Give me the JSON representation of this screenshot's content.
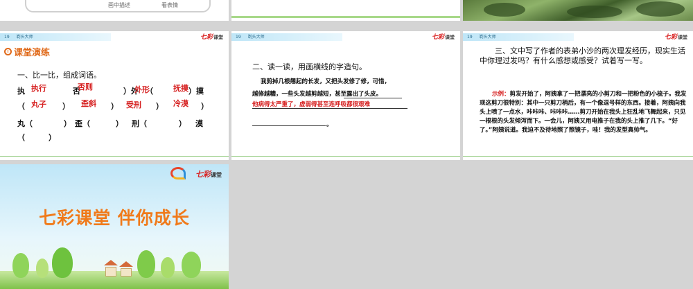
{
  "top_slides": {
    "slide_a": {
      "text1": "画中描述",
      "text2": "看表情"
    }
  },
  "slide_header": {
    "number": "19",
    "lesson": "剃头大师"
  },
  "logo": {
    "brand": "七彩",
    "sub": "课堂"
  },
  "slide1": {
    "title": "课堂演练",
    "question": "一、比一比，组成词语。",
    "row1": {
      "c1": "执",
      "a1": "执行",
      "c2": "否",
      "a2": "否则",
      "c3": "）外",
      "a3": "外形",
      "c4": "（",
      "a4": "抚摸",
      "c5": "）摸"
    },
    "row2": {
      "c1": "（",
      "a1": "丸子",
      "c2": "）",
      "a2": "歪斜",
      "c3": "）",
      "a3": "受刑",
      "c4": "）",
      "a4": "冷漠",
      "c5": "）"
    },
    "row3": {
      "c1": "丸（",
      "c2": "）",
      "c3": "歪（",
      "c4": "）",
      "c5": "刑（",
      "c6": "）",
      "c7": "漠"
    },
    "row4": {
      "c1": "（",
      "c2": "）"
    }
  },
  "slide2": {
    "title": "二、读一读，用画横线的字造句。",
    "line1": "我剪掉几根翘起的长发，又把头发修了修，可惜，",
    "line2": "越修越糟，一些头发越剪越短，甚至露出了头皮。",
    "answer": "他病得太严重了，虚弱得甚至连呼吸都很艰难",
    "end_mark": "。"
  },
  "slide3": {
    "question": "三、文中写了作者的表弟小沙的两次理发经历，现实生活中你理过发吗？有什么感想或感受？试着写一写。",
    "example_label": "示例：",
    "example_text": "剪发开始了，阿姨拿了一把漂亮的小剪刀和一把粉色的小梳子。我发现这剪刀很特别：其中一只剪刀柄后，有一个像逗号样的东西。接着，阿姨向我头上喷了一点水，咔咔咔、咔咔咔……剪刀开始在我头上狂乱地飞舞起来，只见一根根的头发倾泻而下。一会儿，阿姨又用电推子在我的头上推了几下。“好了。”阿姨说道。我迫不及待地照了照镜子，哇！我的发型真帅气。"
  },
  "slide4": {
    "slogan": "七彩课堂  伴你成长",
    "logo_brand": "七彩",
    "logo_sub": "课堂"
  },
  "colors": {
    "accent_red": "#d62020",
    "accent_orange": "#f07a1a",
    "background_gray": "#d4d4d4"
  }
}
